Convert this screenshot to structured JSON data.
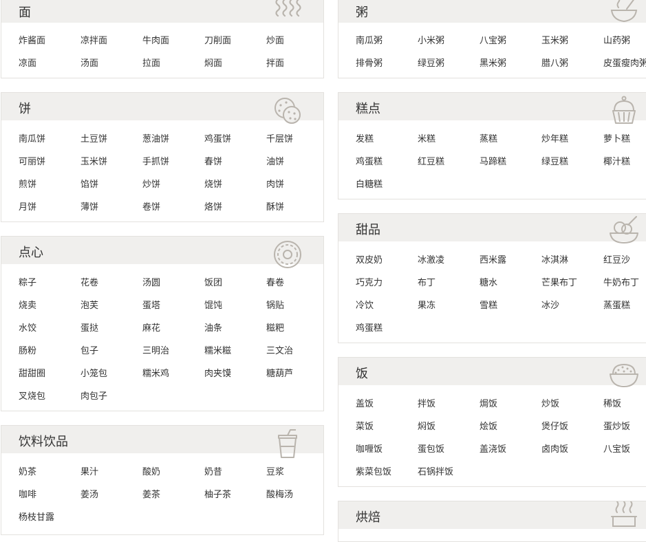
{
  "categories_left": [
    {
      "key": "mian",
      "title": "面",
      "icon": "noodle-steam-icon",
      "items": [
        "炸酱面",
        "凉拌面",
        "牛肉面",
        "刀削面",
        "炒面",
        "凉面",
        "汤面",
        "拉面",
        "焖面",
        "拌面"
      ]
    },
    {
      "key": "bing",
      "title": "饼",
      "icon": "cookie-icon",
      "items": [
        "南瓜饼",
        "土豆饼",
        "葱油饼",
        "鸡蛋饼",
        "千层饼",
        "可丽饼",
        "玉米饼",
        "手抓饼",
        "春饼",
        "油饼",
        "煎饼",
        "馅饼",
        "炒饼",
        "烧饼",
        "肉饼",
        "月饼",
        "薄饼",
        "卷饼",
        "烙饼",
        "酥饼"
      ]
    },
    {
      "key": "dianxin",
      "title": "点心",
      "icon": "donut-icon",
      "items": [
        "粽子",
        "花卷",
        "汤圆",
        "饭团",
        "春卷",
        "烧卖",
        "泡芙",
        "蛋塔",
        "馄饨",
        "锅贴",
        "水饺",
        "蛋挞",
        "麻花",
        "油条",
        "糍粑",
        "肠粉",
        "包子",
        "三明治",
        "糯米糍",
        "三文治",
        "甜甜圈",
        "小笼包",
        "糯米鸡",
        "肉夹馍",
        "糖葫芦",
        "叉烧包",
        "肉包子"
      ]
    },
    {
      "key": "yinliao",
      "title": "饮料饮品",
      "icon": "drink-cup-icon",
      "items": [
        "奶茶",
        "果汁",
        "酸奶",
        "奶昔",
        "豆浆",
        "咖啡",
        "姜汤",
        "姜茶",
        "柚子茶",
        "酸梅汤",
        "杨枝甘露"
      ]
    }
  ],
  "categories_right": [
    {
      "key": "zhou",
      "title": "粥",
      "icon": "porridge-bowl-icon",
      "items": [
        "南瓜粥",
        "小米粥",
        "八宝粥",
        "玉米粥",
        "山药粥",
        "排骨粥",
        "绿豆粥",
        "黑米粥",
        "腊八粥",
        "皮蛋瘦肉粥"
      ]
    },
    {
      "key": "gaodian",
      "title": "糕点",
      "icon": "cupcake-icon",
      "items": [
        "发糕",
        "米糕",
        "蒸糕",
        "炒年糕",
        "萝卜糕",
        "鸡蛋糕",
        "红豆糕",
        "马蹄糕",
        "绿豆糕",
        "椰汁糕",
        "白糖糕"
      ]
    },
    {
      "key": "tianpin",
      "title": "甜品",
      "icon": "ice-cream-bowl-icon",
      "items": [
        "双皮奶",
        "冰激凌",
        "西米露",
        "冰淇淋",
        "红豆沙",
        "巧克力",
        "布丁",
        "糖水",
        "芒果布丁",
        "牛奶布丁",
        "冷饮",
        "果冻",
        "雪糕",
        "冰沙",
        "蒸蛋糕",
        "鸡蛋糕"
      ]
    },
    {
      "key": "fan",
      "title": "饭",
      "icon": "rice-bowl-icon",
      "items": [
        "盖饭",
        "拌饭",
        "焗饭",
        "炒饭",
        "稀饭",
        "菜饭",
        "焖饭",
        "烩饭",
        "煲仔饭",
        "蛋炒饭",
        "咖喱饭",
        "蛋包饭",
        "盖浇饭",
        "卤肉饭",
        "八宝饭",
        "紫菜包饭",
        "石锅拌饭"
      ]
    },
    {
      "key": "hongbei",
      "title": "烘焙",
      "icon": "baking-steam-icon",
      "items": []
    }
  ]
}
